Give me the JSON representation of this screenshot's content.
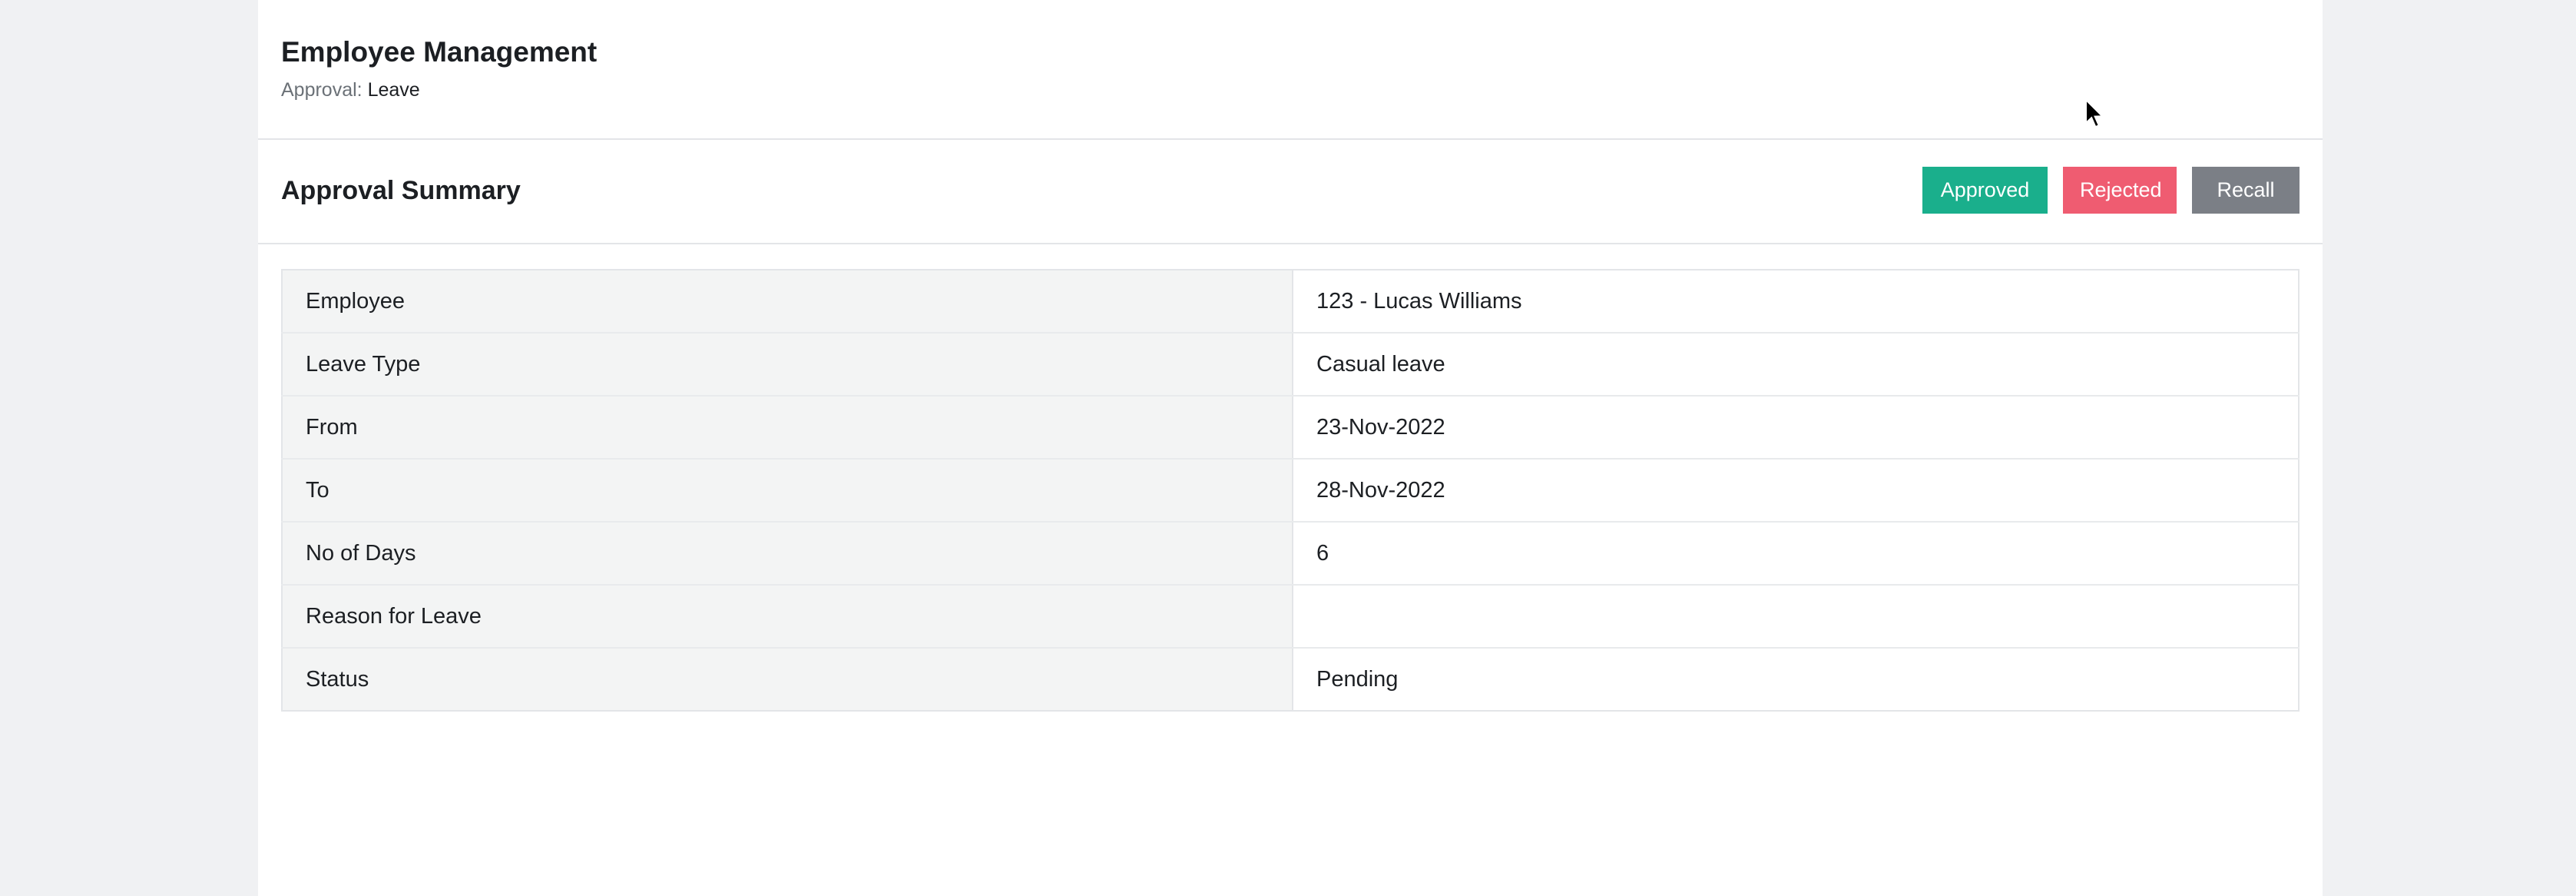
{
  "header": {
    "title": "Employee Management",
    "breadcrumb_label": "Approval:",
    "breadcrumb_current": "Leave"
  },
  "section": {
    "title": "Approval Summary",
    "actions": {
      "approve_label": "Approved",
      "reject_label": "Rejected",
      "recall_label": "Recall"
    }
  },
  "summary": {
    "rows": [
      {
        "label": "Employee",
        "value": "123 - Lucas Williams"
      },
      {
        "label": "Leave Type",
        "value": "Casual leave"
      },
      {
        "label": "From",
        "value": "23-Nov-2022"
      },
      {
        "label": "To",
        "value": "28-Nov-2022"
      },
      {
        "label": "No of Days",
        "value": "6"
      },
      {
        "label": "Reason for Leave",
        "value": ""
      },
      {
        "label": "Status",
        "value": "Pending"
      }
    ]
  },
  "colors": {
    "approve": "#1aaf8c",
    "reject": "#ef5c71",
    "recall": "#7b7f86",
    "page_background": "#f0f1f3"
  },
  "icons": {
    "cursor": "mouse-pointer-icon"
  }
}
